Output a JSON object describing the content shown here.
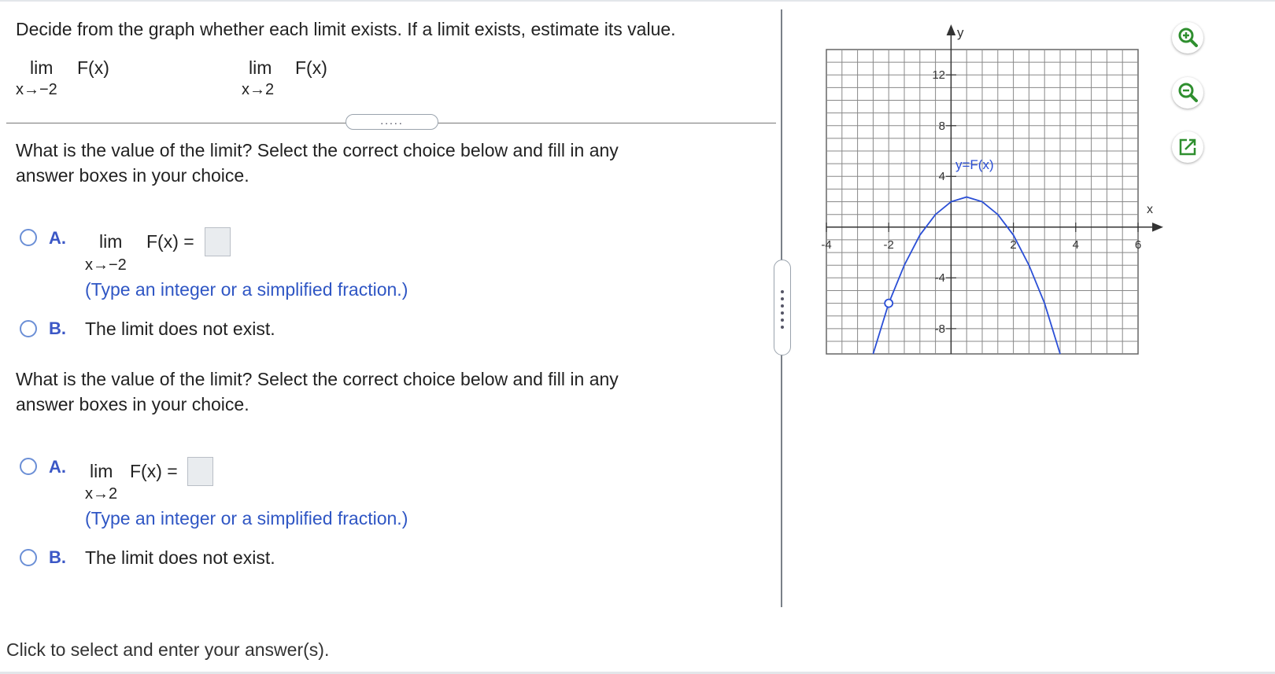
{
  "instruction": "Decide from the graph whether each limit exists. If a limit exists, estimate its value.",
  "limits": [
    {
      "op": "lim",
      "func": "F(x)",
      "approach": "x→−2"
    },
    {
      "op": "lim",
      "func": "F(x)",
      "approach": "x→2"
    }
  ],
  "expander_label": ".....",
  "questions": [
    {
      "prompt_line1": "What is the value of the limit? Select the correct choice below and fill in any",
      "prompt_line2": "answer boxes in your choice.",
      "choice_a": {
        "label": "A.",
        "op": "lim",
        "func": "F(x) =",
        "approach": "x→−2",
        "hint": "(Type an integer or a simplified fraction.)",
        "value": ""
      },
      "choice_b": {
        "label": "B.",
        "text": "The limit does not exist."
      }
    },
    {
      "prompt_line1": "What is the value of the limit? Select the correct choice below and fill in any",
      "prompt_line2": "answer boxes in your choice.",
      "choice_a": {
        "label": "A.",
        "op": "lim",
        "func": "F(x) =",
        "approach": "x→2",
        "hint": "(Type an integer or a simplified fraction.)",
        "value": ""
      },
      "choice_b": {
        "label": "B.",
        "text": "The limit does not exist."
      }
    }
  ],
  "footer": "Click to select and enter your answer(s).",
  "graph": {
    "y_axis_label": "y",
    "x_axis_label": "x",
    "curve_label": "y=F(x)",
    "x_ticks": [
      "-4",
      "-2",
      "2",
      "4",
      "6"
    ],
    "y_ticks": [
      "12",
      "8",
      "4",
      "-4",
      "-8"
    ],
    "curve_color": "#2b4fd6"
  },
  "tools": [
    "zoom-in-icon",
    "zoom-out-icon",
    "open-in-new-window-icon"
  ]
}
